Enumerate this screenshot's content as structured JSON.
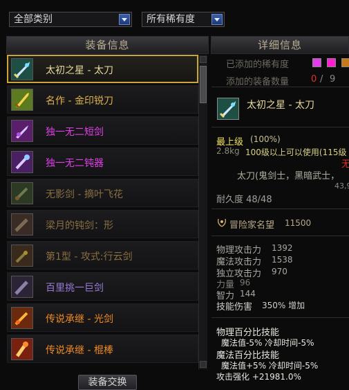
{
  "filters": {
    "category": "全部类别",
    "rarity": "所有稀有度"
  },
  "equip_panel": {
    "title": "装备信息",
    "items": [
      {
        "name": "太初之星 - 太刀",
        "color": "#e8d9a0",
        "icon": "greatsword-icon"
      },
      {
        "name": "名作 - 金印锐刀",
        "color": "#e0b24c",
        "icon": "golden-blade-icon"
      },
      {
        "name": "独一无二短剑",
        "color": "#e23ee8",
        "icon": "short-sword-icon"
      },
      {
        "name": "独一无二钝器",
        "color": "#e23ee8",
        "icon": "blunt-weapon-icon"
      },
      {
        "name": "无影剑 - 摘叶飞花",
        "color": "#8a6f42",
        "icon": "shadow-sword-icon"
      },
      {
        "name": "梁月的钝剑：形",
        "color": "#8a6f42",
        "icon": "blunt-sword-icon"
      },
      {
        "name": "第1型 - 攻式:行云剑",
        "color": "#8a6f42",
        "icon": "cloud-sword-icon"
      },
      {
        "name": "百里挑一巨剑",
        "color": "#9b7bd8",
        "icon": "giant-sword-icon"
      },
      {
        "name": "传说承继 - 光剑",
        "color": "#f08a24",
        "icon": "light-sword-icon"
      },
      {
        "name": "传说承继 - 棍棒",
        "color": "#f08a24",
        "icon": "club-icon"
      }
    ],
    "swap_button": "装备交换"
  },
  "detail_panel": {
    "title": "详细信息",
    "added_rarity_label": "已添加的稀有度",
    "rarity_colors": [
      "#e23ee8",
      "#ff1fd0",
      "#c87a1a"
    ],
    "added_count_label": "添加的装备数量",
    "added_count": "0",
    "added_count_sep": "/",
    "added_count_max": "9",
    "item_name": "太初之星 - 太刀",
    "grade": "最上级",
    "grade_pct": "(100%)",
    "weight": "2.8kg",
    "level_req": "100级以上可以使用(115级",
    "edge_fragment": "无",
    "classes": "太刀(鬼剑士，黑暗武士，",
    "price": "43,9",
    "durability": "耐久度 48/48",
    "adventurer_fame_label": "冒险家名望",
    "adventurer_fame": "11500",
    "stats": [
      {
        "label": "物理攻击力",
        "value": "1392"
      },
      {
        "label": "魔法攻击力",
        "value": "1538"
      },
      {
        "label": "独立攻击力",
        "value": "970"
      },
      {
        "label": "力量",
        "value": "96"
      },
      {
        "label": "智力",
        "value": "144"
      },
      {
        "label": "技能伤害",
        "value": "350% 增加"
      }
    ],
    "skills": [
      "物理百分比技能",
      "魔法值-5% 冷却时间-5%",
      "魔法百分比技能",
      "魔法值+5% 冷却时间-5%",
      "攻击强化 +21981.0%"
    ]
  }
}
